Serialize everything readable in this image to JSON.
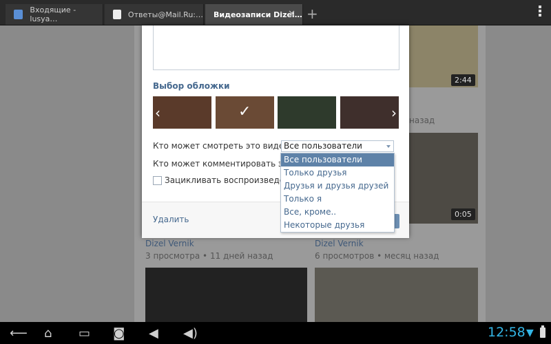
{
  "tabs": [
    {
      "label": "Входящие - lusya…",
      "color": "#5a8fd6"
    },
    {
      "label": "Ответы@Mail.Ru:…",
      "color": "#999999"
    },
    {
      "label": "Видеозаписи Dizel…",
      "color": "#4a4a4a"
    }
  ],
  "background": {
    "videos": [
      {
        "author": "Dizel Vernik",
        "views": "3 просмотра",
        "age": "11 дней назад"
      },
      {
        "author": "Dizel Vernik",
        "views": "6 просмотров",
        "age": "месяц назад"
      }
    ],
    "durations": [
      "2:44",
      "0:05"
    ],
    "age_top": "назад",
    "age_mid": "назад"
  },
  "modal": {
    "cover_title": "Выбор обложки",
    "who_can_view": "Кто может смотреть это видео?",
    "who_can_comment": "Кто может комментировать это",
    "loop_label": "Зацикливать воспроизведен",
    "privacy_selected": "Все пользователи",
    "delete_label": "Удалить"
  },
  "privacy_options": [
    "Все пользователи",
    "Только друзья",
    "Друзья и друзья друзей",
    "Только я",
    "Все, кроме..",
    "Некоторые друзья"
  ],
  "system": {
    "clock": "12:58"
  },
  "colors": {
    "accent": "#45688e",
    "selected": "#5e82a8",
    "clock": "#33b5e5"
  }
}
